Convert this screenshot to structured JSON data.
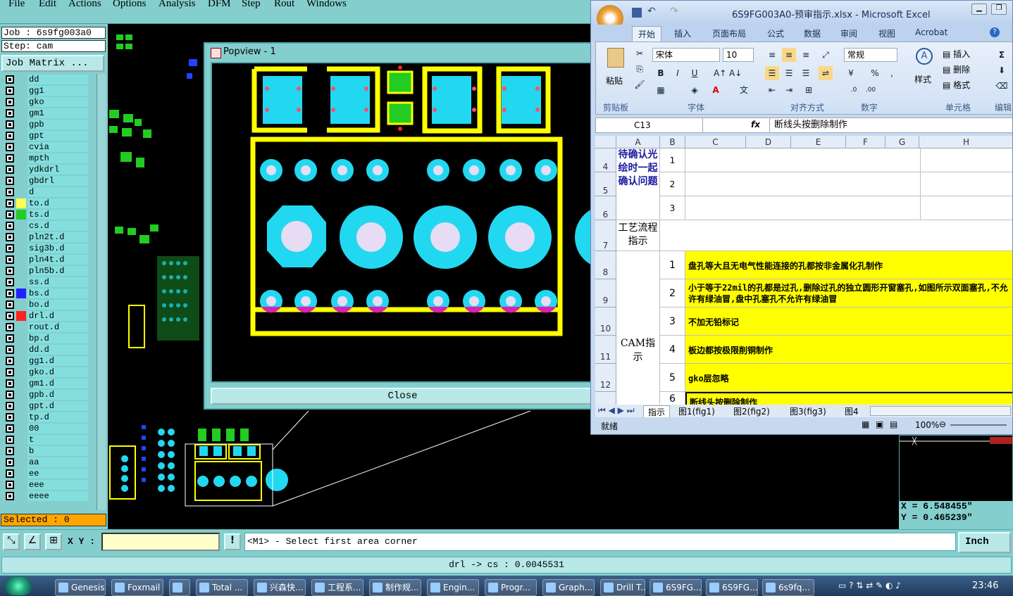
{
  "menu": [
    "File",
    "Edit",
    "Actions",
    "Options",
    "Analysis",
    "DFM",
    "Step",
    "Rout",
    "Windows"
  ],
  "job": {
    "job_label": "Job : 6s9fg003a0",
    "step_label": "Step: cam",
    "matrix_button": "Job Matrix ..."
  },
  "layers": [
    {
      "name": "dd",
      "color": ""
    },
    {
      "name": "gg1",
      "color": ""
    },
    {
      "name": "gko",
      "color": ""
    },
    {
      "name": "gm1",
      "color": ""
    },
    {
      "name": "gpb",
      "color": ""
    },
    {
      "name": "gpt",
      "color": ""
    },
    {
      "name": "cvia",
      "color": ""
    },
    {
      "name": "mpth",
      "color": ""
    },
    {
      "name": "ydkdrl",
      "color": ""
    },
    {
      "name": "gbdrl",
      "color": ""
    },
    {
      "name": "d",
      "color": ""
    },
    {
      "name": "to.d",
      "color": "#ffff55"
    },
    {
      "name": "ts.d",
      "color": "#22cc22"
    },
    {
      "name": "cs.d",
      "color": ""
    },
    {
      "name": "pln2t.d",
      "color": ""
    },
    {
      "name": "sig3b.d",
      "color": ""
    },
    {
      "name": "pln4t.d",
      "color": ""
    },
    {
      "name": "pln5b.d",
      "color": ""
    },
    {
      "name": "ss.d",
      "color": ""
    },
    {
      "name": "bs.d",
      "color": "#2222ff"
    },
    {
      "name": "bo.d",
      "color": ""
    },
    {
      "name": "drl.d",
      "color": "#ff2222"
    },
    {
      "name": "rout.d",
      "color": ""
    },
    {
      "name": "bp.d",
      "color": ""
    },
    {
      "name": "dd.d",
      "color": ""
    },
    {
      "name": "gg1.d",
      "color": ""
    },
    {
      "name": "gko.d",
      "color": ""
    },
    {
      "name": "gm1.d",
      "color": ""
    },
    {
      "name": "gpb.d",
      "color": ""
    },
    {
      "name": "gpt.d",
      "color": ""
    },
    {
      "name": "tp.d",
      "color": ""
    },
    {
      "name": "00",
      "color": ""
    },
    {
      "name": "t",
      "color": ""
    },
    {
      "name": "b",
      "color": ""
    },
    {
      "name": "aa",
      "color": ""
    },
    {
      "name": "ee",
      "color": ""
    },
    {
      "name": "eee",
      "color": ""
    },
    {
      "name": "eeee",
      "color": ""
    }
  ],
  "selected_label": "Selected : 0",
  "popview": {
    "title": "Popview - 1",
    "close_label": "Close"
  },
  "excel": {
    "window_title": "6S9FG003A0-预审指示.xlsx - Microsoft Excel",
    "tabs": [
      "开始",
      "插入",
      "页面布局",
      "公式",
      "数据",
      "审阅",
      "视图",
      "Acrobat"
    ],
    "paste_label": "粘贴",
    "font_name": "宋体",
    "font_size": "10",
    "number_format": "常规",
    "style_label": "样式",
    "cells_items": [
      "插入",
      "删除",
      "格式"
    ],
    "edit_label": "编辑",
    "group_labels": [
      "剪贴板",
      "字体",
      "对齐方式",
      "数字",
      "单元格"
    ],
    "name_box": "C13",
    "fx": "fx",
    "formula": "断线头按删除制作",
    "columns": [
      "A",
      "B",
      "C",
      "D",
      "E",
      "F",
      "G",
      "H"
    ],
    "rows": [
      {
        "num": "4",
        "b": "1",
        "text": ""
      },
      {
        "num": "5",
        "b": "2",
        "text": ""
      },
      {
        "num": "6",
        "b": "3",
        "text": ""
      },
      {
        "num": "7",
        "b": "",
        "text": ""
      },
      {
        "num": "8",
        "b": "1",
        "text": "盘孔等大且无电气性能连接的孔都按非金属化孔制作"
      },
      {
        "num": "9",
        "b": "2",
        "text": "小于等于22mil的孔都是过孔,删除过孔的独立圆形开窗塞孔,如图所示双面塞孔,不允许有绿油冒,盘中孔塞孔不允许有绿油冒"
      },
      {
        "num": "10",
        "b": "3",
        "text": "不加无铅标记"
      },
      {
        "num": "11",
        "b": "4",
        "text": "板边都按极限削铜制作"
      },
      {
        "num": "12",
        "b": "5",
        "text": "gko层忽略"
      },
      {
        "num": "",
        "b": "6",
        "text": "断线头按删除制作"
      }
    ],
    "a_label_confirm": "待确认光绘时一起确认问题",
    "a_label_process": "工艺流程指示",
    "a_label_cam": "CAM指示",
    "sheets": [
      "指示",
      "图1(fig1)",
      "图2(fig2)",
      "图3(fig3)",
      "图4"
    ],
    "status_ready": "就绪",
    "zoom": "100%"
  },
  "coords": {
    "x": "X = 6.548455\"",
    "y": "Y = 0.465239\""
  },
  "toolbar": {
    "xy_label": "X Y :",
    "prompt": "<M1> - Select first area corner",
    "unit": "Inch"
  },
  "status": "drl -> cs : 0.0045531",
  "taskbar": {
    "tasks": [
      "Genesis",
      "Foxmail",
      "",
      "Total ...",
      "兴森快...",
      "工程系...",
      "制作规...",
      "Engin...",
      "Progr...",
      "Graph...",
      "Drill T...",
      "6S9FG...",
      "6S9FG...",
      "6s9fq..."
    ],
    "clock": "23:46"
  },
  "colors": {
    "panel": "#84cece",
    "pad_cyan": "#22d8f0",
    "outline_yellow": "#ffff00",
    "pad_green": "#22cc22"
  }
}
